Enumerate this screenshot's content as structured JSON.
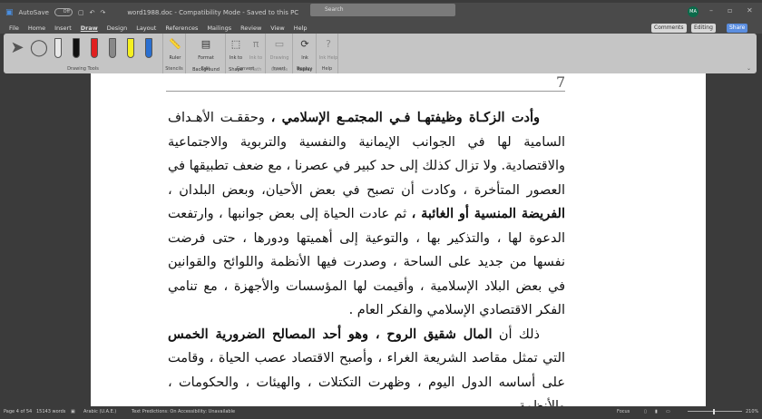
{
  "titlebar": {
    "autosave": "AutoSave",
    "toggle": "Off",
    "title": "word1988.doc - Compatibility Mode - Saved to this PC",
    "search": "Search",
    "avatar": "MA"
  },
  "menu": [
    "File",
    "Home",
    "Insert",
    "Draw",
    "Design",
    "Layout",
    "References",
    "Mailings",
    "Review",
    "View",
    "Help"
  ],
  "right_buttons": {
    "comments": "Comments",
    "editing": "Editing",
    "share": "Share"
  },
  "ribbon": {
    "drawing_tools": "Drawing Tools",
    "ruler": "Ruler",
    "stencils": "Stencils",
    "format_bg": "Format Background",
    "edit": "Edit",
    "ink_shape": "Ink to Shape",
    "ink_math": "Ink to Math",
    "convert": "Convert",
    "drawing_canvas": "Drawing Canvas",
    "insert": "Insert",
    "ink_replay": "Ink Replay",
    "replay": "Replay",
    "ink_help": "Ink Help",
    "help": "Help",
    "pen_colors": [
      "#e8e8e8",
      "#111111",
      "#e02020",
      "#888888",
      "#f5f020",
      "#2a6fd0"
    ]
  },
  "document": {
    "page_number": "7",
    "p1_bold": "وأدت الزكـاة وظيفتهـا فـي المجتمـع الإسلامي ،",
    "p1_rest": " وحققـت الأهـداف السامية لها في الجوانب الإيمانية والنفسية والتربوية والاجتماعية والاقتصادية. ولا تزال كذلك إلى حد كبير في عصرنا ، مع ضعف تطبيقها في العصور المتأخرة ، وكادت أن تصبح في بعض الأحيان، وبعض البلدان ، ",
    "p1_bold2": "الفريضة المنسية أو الغائبة ،",
    "p1_rest2": " ثم عادت الحياة إلى بعض جوانبها ، وارتفعت الدعوة لها ، والتذكير بها ، والتوعية إلى أهميتها ودورها ، حتى فرضت نفسها من جديد على الساحة ، وصدرت فيها الأنظمة واللوائح والقوانين في بعض البلاد الإسلامية ، وأقيمت لها المؤسسات والأجهزة ، مع تنامي الفكر الاقتصادي الإسلامي والفكر العام .",
    "p2_start": "ذلك أن ",
    "p2_bold": "المال شقيق الروح ، وهو أحد المصالح الضرورية الخمس",
    "p2_rest": " التي تمثل مقاصد الشريعة الغراء ، وأصبح الاقتصاد عصب الحياة ، وقامت على أساسه الدول اليوم ، وظهرت التكتلات ، والهيئات ، والحكومات ، والأنظمة"
  },
  "status": {
    "page": "Page 4 of 54",
    "words": "15143 words",
    "language": "Arabic (U.A.E.)",
    "predictions": "Text Predictions: On",
    "accessibility": "Accessibility: Unavailable",
    "focus": "Focus",
    "zoom": "210%",
    "zoom_level_percent": 210
  }
}
